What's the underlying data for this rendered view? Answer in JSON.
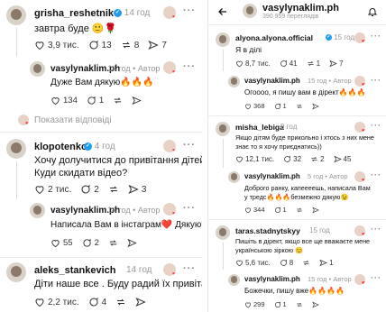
{
  "left": {
    "comments": [
      {
        "user": "grisha_reshetnik",
        "time": "14 год",
        "text": "завтра буде 🙂🌹",
        "likes": "3,9 тис.",
        "replies": "13",
        "reposts": "8",
        "shares": "7"
      },
      {
        "user": "vasylynaklim.ph",
        "time": "14 год",
        "author": "Автор",
        "text": "Дуже Вам дякую🔥🔥🔥",
        "likes": "134",
        "replies": "1"
      },
      {
        "user": "klopotenko",
        "time": "4 год",
        "text1": "Хочу долучитися до привітання дітей)",
        "text2": "Куди скидати відео?",
        "likes": "2 тис.",
        "replies": "2",
        "reposts": "3"
      },
      {
        "user": "vasylynaklim.ph",
        "time": "14 год",
        "author": "Автор",
        "text": "Написала Вам в інстаграм❤️ Дякую❤️🔥",
        "likes": "55",
        "replies": "2"
      },
      {
        "user": "aleks_stankevich",
        "time": "14 год",
        "text": "Діти наше все . Буду радий їх привітати)",
        "likes": "2,2 тис.",
        "replies": "4"
      }
    ],
    "show_replies": "Показати відповіді"
  },
  "right": {
    "header": {
      "title": "vasylynaklim.ph",
      "subtitle": "390 959 переглядів"
    },
    "comments": [
      {
        "user": "alyona.alyona.official",
        "time": "15 год",
        "text": "Я в ділі",
        "likes": "8,7 тис.",
        "replies": "41",
        "reposts": "1",
        "shares": "7"
      },
      {
        "user": "vasylynaklim.ph",
        "time": "15 год",
        "author": "Автор",
        "text": "Огоооо, я пишу вам в дірект🔥🔥🔥",
        "likes": "368",
        "replies": "1"
      },
      {
        "user": "misha_lebiga",
        "time": "9 год",
        "text1": "Якщо дітям буде прикольно і хтось з них мене",
        "text2": "знає то я хочу приєднатись))",
        "likes": "12,1 тис.",
        "replies": "32",
        "reposts": "2",
        "shares": "45"
      },
      {
        "user": "vasylynaklim.ph",
        "time": "5 год",
        "author": "Автор",
        "text1": "Доброго ранку, капеееешь, написала Вам",
        "text2": "у тредс🔥🔥🔥безмежно дякую😉",
        "likes": "344",
        "replies": "1"
      },
      {
        "user": "taras.stadnytskyy",
        "time": "15 год",
        "text1": "Пишіть в дірект, якщо все ще вважаєте мене",
        "text2": "українською зіркою 😊",
        "likes": "5,6 тис.",
        "replies": "8",
        "reposts": "1"
      },
      {
        "user": "vasylynaklim.ph",
        "time": "15 год",
        "author": "Автор",
        "text": "Божечки, пишу вже🔥🔥🔥🔥",
        "likes": "299",
        "replies": "1"
      }
    ]
  },
  "colors": {
    "like": "#ff3040",
    "verified": "#1d9bf0",
    "muted": "#999999"
  }
}
